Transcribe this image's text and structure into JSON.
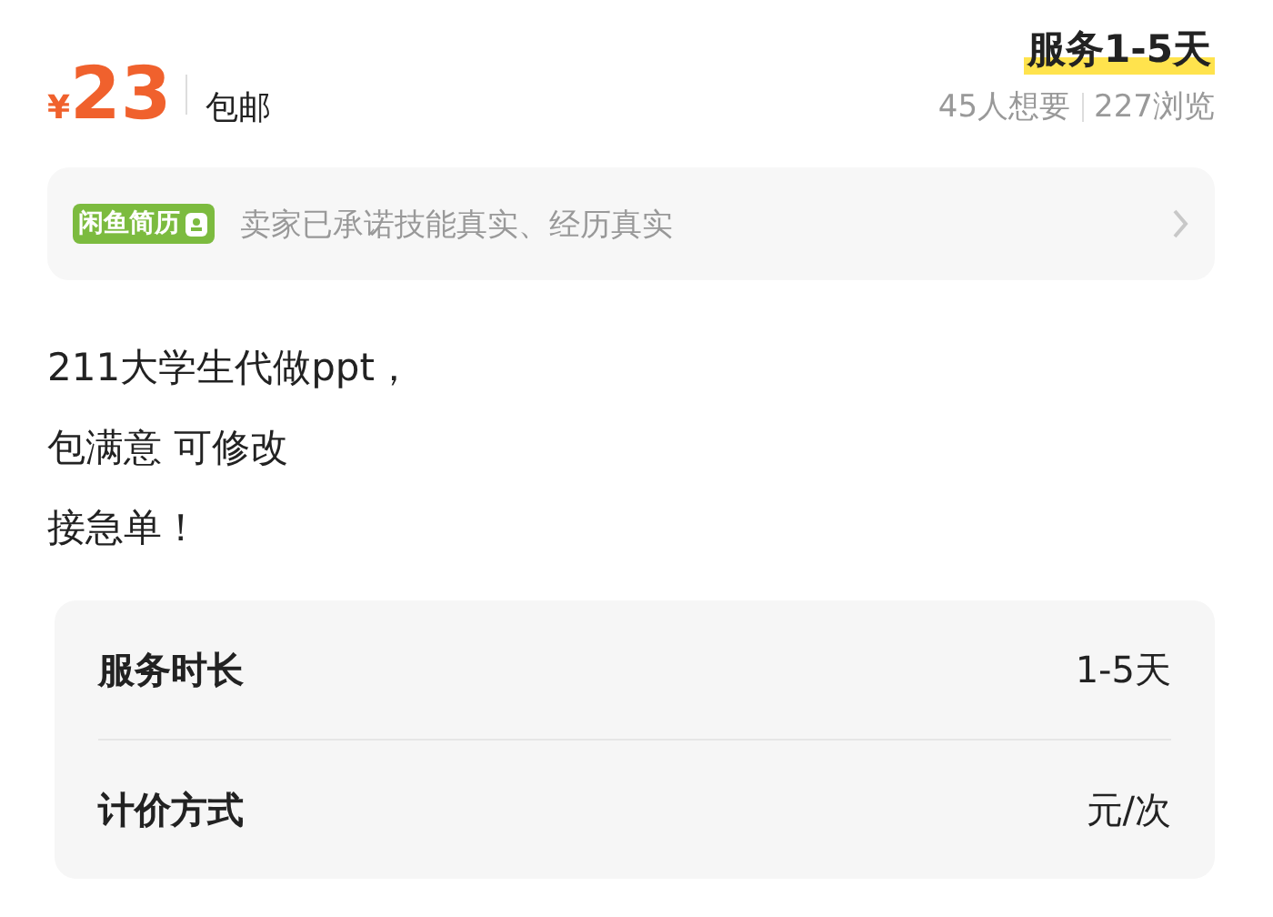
{
  "price": {
    "currency": "¥",
    "amount": "23",
    "shipping": "包邮"
  },
  "title": "服务1-5天",
  "stats": [
    "45人想要",
    "227浏览"
  ],
  "banner": {
    "badge": "闲鱼简历",
    "text": "卖家已承诺技能真实、经历真实"
  },
  "description": [
    "211大学生代做ppt，",
    "包满意 可修改",
    "接急单！"
  ],
  "details": [
    {
      "label": "服务时长",
      "value": "1-5天"
    },
    {
      "label": "计价方式",
      "value": "元/次"
    }
  ]
}
